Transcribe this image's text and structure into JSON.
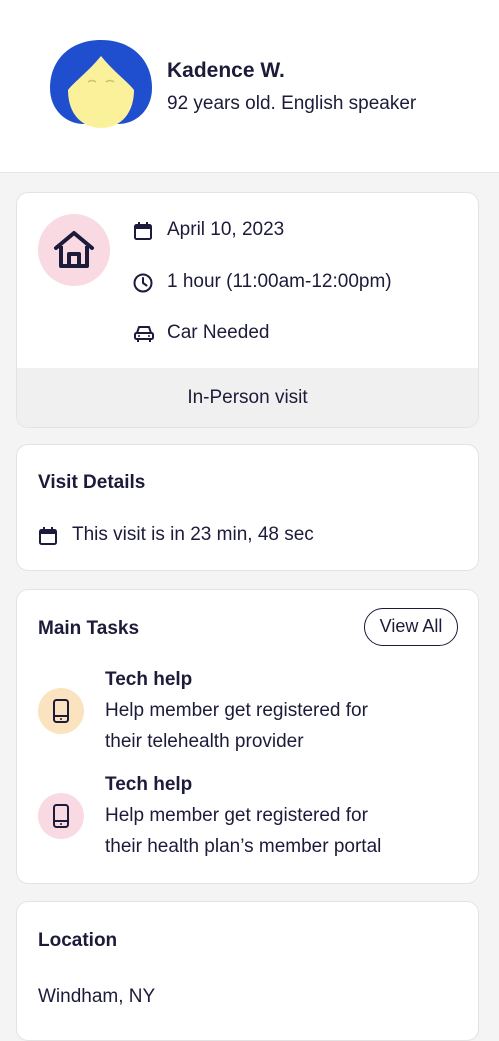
{
  "profile": {
    "name": "Kadence W.",
    "subtitle": "92 years old. English speaker"
  },
  "visit": {
    "date": "April 10, 2023",
    "duration": "1 hour (11:00am-12:00pm)",
    "transport": "Car Needed",
    "type": "In-Person visit"
  },
  "details": {
    "title": "Visit Details",
    "countdown": "This visit is in 23 min, 48 sec"
  },
  "tasks": {
    "title": "Main Tasks",
    "view_all_label": "View All",
    "items": [
      {
        "title": "Tech help",
        "line1": "Help member get registered for",
        "line2": "their telehealth provider",
        "icon_color": "#fbe3c0"
      },
      {
        "title": "Tech help",
        "line1": "Help member get registered for",
        "line2": "their health plan’s member portal",
        "icon_color": "#f9d9e2"
      }
    ]
  },
  "location": {
    "title": "Location",
    "value": "Windham, NY"
  },
  "icons": {
    "avatar": "avatar-illustration",
    "home": "home-icon",
    "calendar": "calendar-icon",
    "clock": "clock-icon",
    "car": "car-icon",
    "phone": "phone-icon"
  },
  "colors": {
    "text": "#1c1b3a",
    "avatar_hair": "#1f4fcf",
    "avatar_face": "#fbf19a",
    "pink": "#f9d9e2",
    "peach": "#fbe3c0"
  }
}
